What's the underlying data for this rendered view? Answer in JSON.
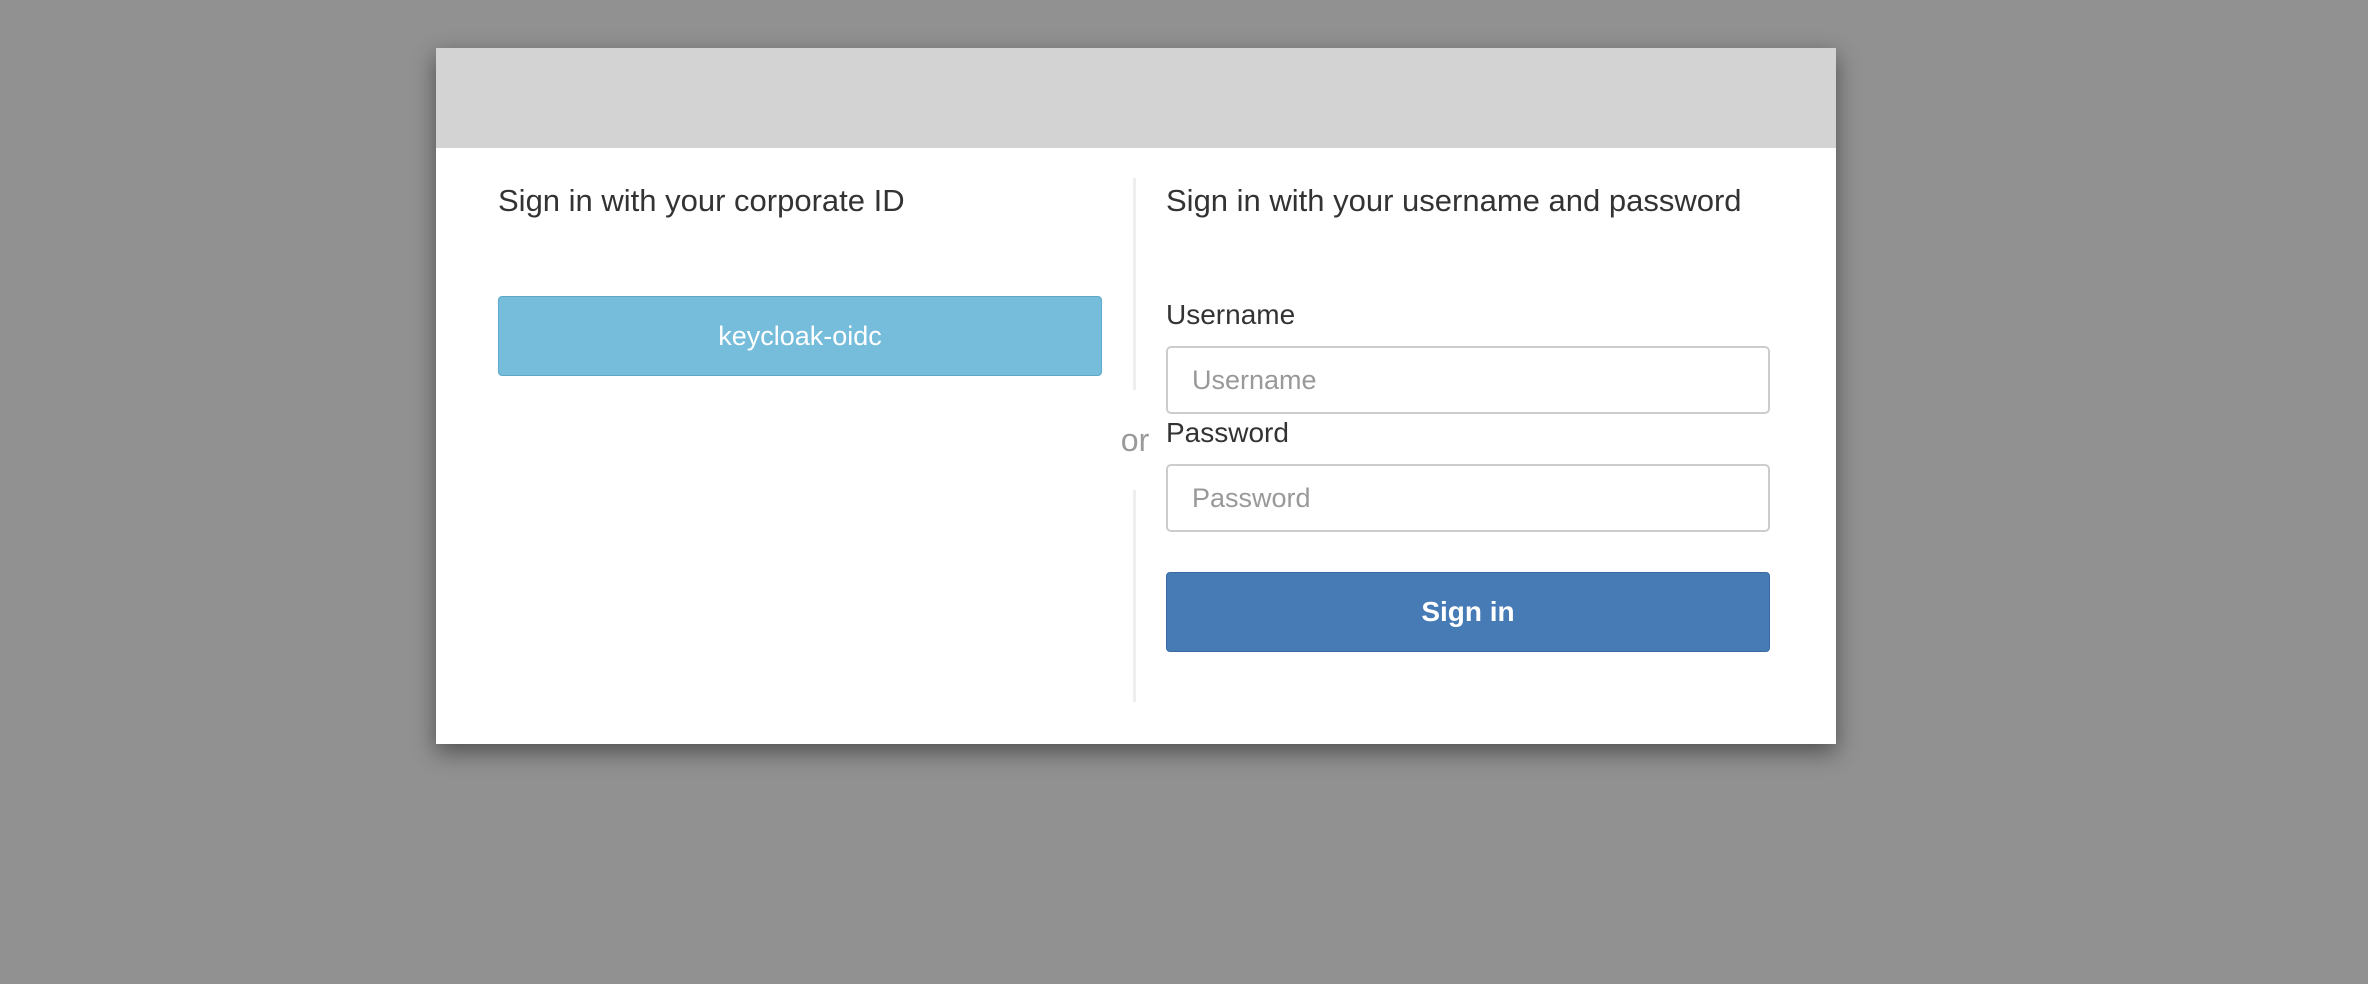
{
  "left_panel": {
    "heading": "Sign in with your corporate ID",
    "provider_button_label": "keycloak-oidc"
  },
  "divider": {
    "text": "or"
  },
  "right_panel": {
    "heading": "Sign in with your username and password",
    "username_label": "Username",
    "username_placeholder": "Username",
    "username_value": "",
    "password_label": "Password",
    "password_placeholder": "Password",
    "password_value": "",
    "submit_label": "Sign in"
  },
  "colors": {
    "background": "#919191",
    "header": "#d3d3d3",
    "provider_button": "#76bddb",
    "submit_button": "#467bb5"
  }
}
